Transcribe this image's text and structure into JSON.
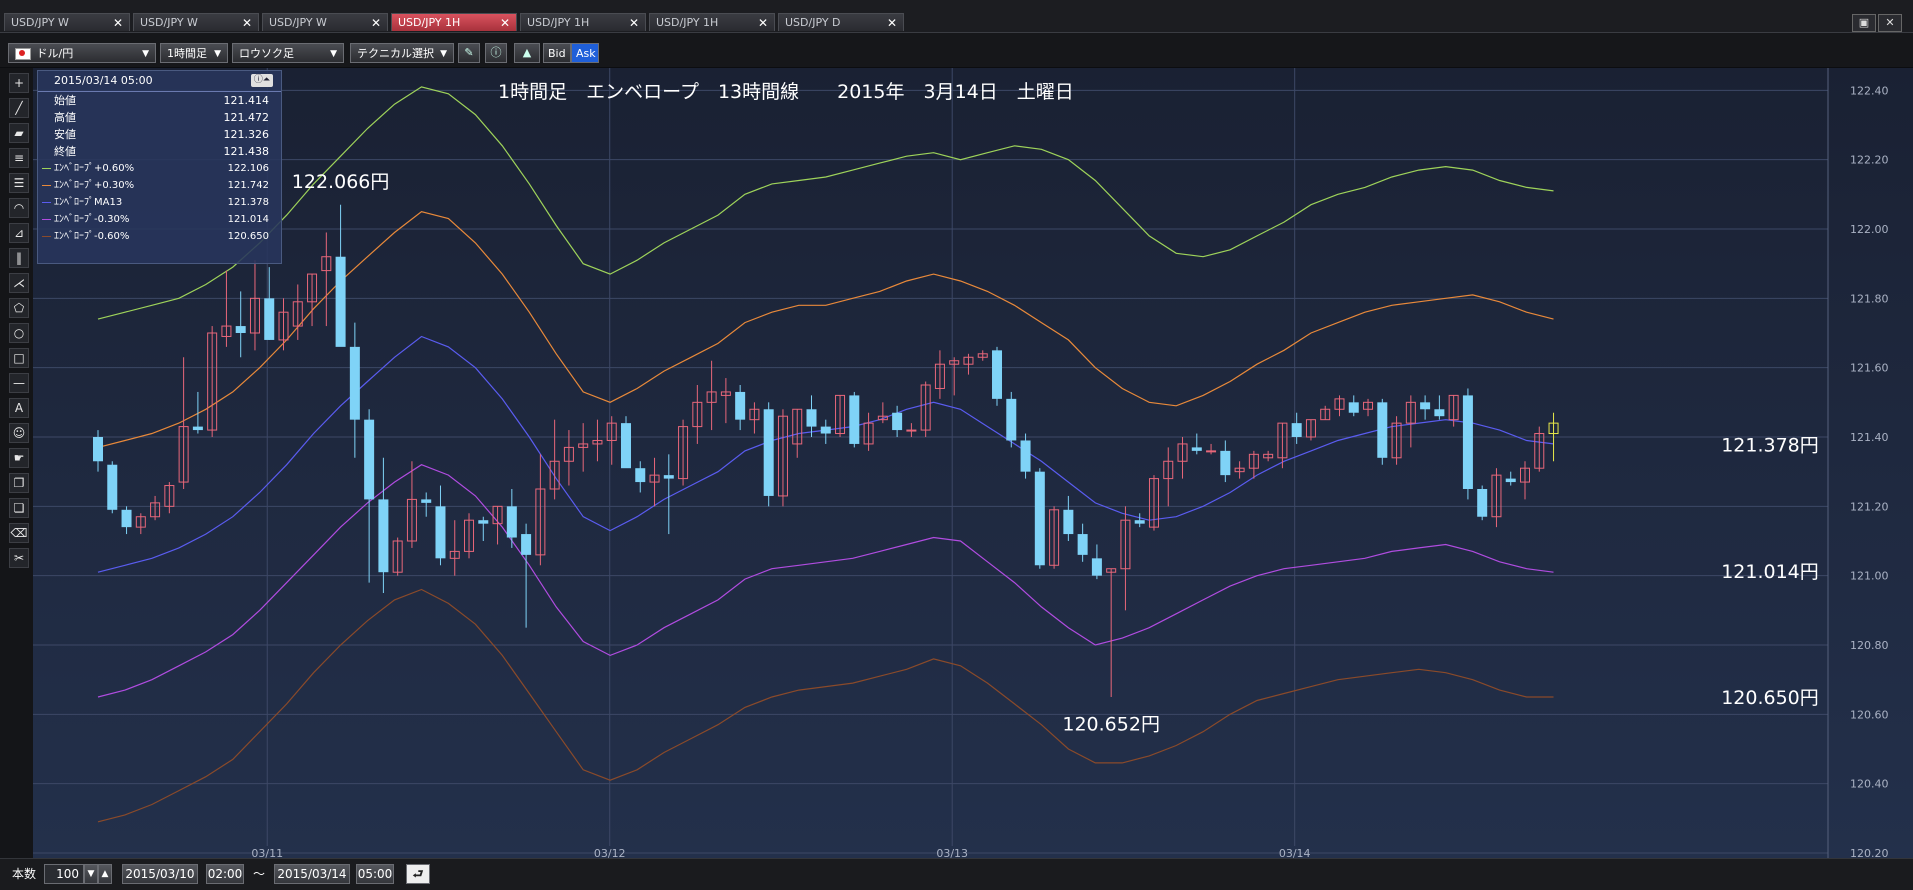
{
  "tabs": [
    {
      "label": "USD/JPY W",
      "active": false
    },
    {
      "label": "USD/JPY W",
      "active": false
    },
    {
      "label": "USD/JPY W",
      "active": false
    },
    {
      "label": "USD/JPY 1H",
      "active": true
    },
    {
      "label": "USD/JPY 1H",
      "active": false
    },
    {
      "label": "USD/JPY 1H",
      "active": false
    },
    {
      "label": "USD/JPY D",
      "active": false
    }
  ],
  "toolbar": {
    "symbol": "ドル/円",
    "timeframe": "1時間足",
    "chart_type": "ロウソク足",
    "technical": "テクニカル選択",
    "bid": "Bid",
    "ask": "Ask"
  },
  "ohlc_panel": {
    "datetime": "2015/03/14 05:00",
    "rows": [
      {
        "label": "始値",
        "value": "121.414"
      },
      {
        "label": "高値",
        "value": "121.472"
      },
      {
        "label": "安値",
        "value": "121.326"
      },
      {
        "label": "終値",
        "value": "121.438"
      }
    ],
    "indicators": [
      {
        "label": "ｴﾝﾍﾞﾛｰﾌﾟ+0.60%",
        "value": "122.106",
        "color": "#9ed35a"
      },
      {
        "label": "ｴﾝﾍﾞﾛｰﾌﾟ+0.30%",
        "value": "121.742",
        "color": "#e8893a"
      },
      {
        "label": "ｴﾝﾍﾞﾛｰﾌﾟMA13",
        "value": "121.378",
        "color": "#5a5cf0"
      },
      {
        "label": "ｴﾝﾍﾞﾛｰﾌﾟ-0.30%",
        "value": "121.014",
        "color": "#b04ce0"
      },
      {
        "label": "ｴﾝﾍﾞﾛｰﾌﾟ-0.60%",
        "value": "120.650",
        "color": "#8a4a2a"
      }
    ]
  },
  "bottom": {
    "count_label": "本数",
    "count": "100",
    "from_date": "2015/03/10",
    "from_time": "02:00",
    "tilde": "～",
    "to_date": "2015/03/14",
    "to_time": "05:00"
  },
  "chart_data": {
    "type": "candlestick",
    "title": "1時間足　エンベロープ　13時間線　　2015年　3月14日　土曜日",
    "ylim": [
      120.2,
      122.45
    ],
    "yticks": [
      "122.40",
      "122.20",
      "122.00",
      "121.80",
      "121.60",
      "121.40",
      "121.20",
      "121.00",
      "120.80",
      "120.60",
      "120.40",
      "120.20"
    ],
    "xticks": [
      {
        "label": "03/11",
        "index": 12
      },
      {
        "label": "03/12",
        "index": 36
      },
      {
        "label": "03/13",
        "index": 60
      },
      {
        "label": "03/14",
        "index": 84
      }
    ],
    "colors": {
      "up": "#e8677a",
      "down": "#7fd3f7",
      "last": "#e8e84a"
    },
    "candles": [
      [
        121.4,
        121.42,
        121.3,
        121.33
      ],
      [
        121.32,
        121.33,
        121.18,
        121.19
      ],
      [
        121.19,
        121.2,
        121.12,
        121.14
      ],
      [
        121.14,
        121.18,
        121.12,
        121.17
      ],
      [
        121.17,
        121.23,
        121.16,
        121.21
      ],
      [
        121.2,
        121.27,
        121.18,
        121.26
      ],
      [
        121.27,
        121.63,
        121.25,
        121.43
      ],
      [
        121.43,
        121.53,
        121.41,
        121.42
      ],
      [
        121.42,
        121.72,
        121.4,
        121.7
      ],
      [
        121.69,
        121.88,
        121.66,
        121.72
      ],
      [
        121.72,
        121.82,
        121.63,
        121.7
      ],
      [
        121.7,
        121.91,
        121.65,
        121.8
      ],
      [
        121.8,
        121.89,
        121.68,
        121.68
      ],
      [
        121.68,
        121.8,
        121.65,
        121.76
      ],
      [
        121.72,
        121.84,
        121.68,
        121.79
      ],
      [
        121.79,
        121.87,
        121.72,
        121.87
      ],
      [
        121.88,
        121.99,
        121.72,
        121.92
      ],
      [
        121.92,
        122.07,
        121.85,
        121.66
      ],
      [
        121.66,
        121.73,
        121.34,
        121.45
      ],
      [
        121.45,
        121.48,
        120.98,
        121.22
      ],
      [
        121.22,
        121.34,
        120.95,
        121.01
      ],
      [
        121.01,
        121.11,
        121.0,
        121.1
      ],
      [
        121.1,
        121.33,
        121.08,
        121.22
      ],
      [
        121.22,
        121.24,
        121.17,
        121.21
      ],
      [
        121.2,
        121.26,
        121.03,
        121.05
      ],
      [
        121.05,
        121.16,
        121.0,
        121.07
      ],
      [
        121.07,
        121.18,
        121.05,
        121.16
      ],
      [
        121.16,
        121.17,
        121.1,
        121.15
      ],
      [
        121.15,
        121.2,
        121.09,
        121.2
      ],
      [
        121.2,
        121.25,
        121.08,
        121.11
      ],
      [
        121.12,
        121.15,
        120.85,
        121.06
      ],
      [
        121.06,
        121.35,
        121.03,
        121.25
      ],
      [
        121.25,
        121.45,
        121.22,
        121.33
      ],
      [
        121.33,
        121.42,
        121.26,
        121.37
      ],
      [
        121.37,
        121.44,
        121.3,
        121.38
      ],
      [
        121.38,
        121.45,
        121.33,
        121.39
      ],
      [
        121.39,
        121.46,
        121.32,
        121.44
      ],
      [
        121.44,
        121.46,
        121.34,
        121.31
      ],
      [
        121.31,
        121.33,
        121.24,
        121.27
      ],
      [
        121.27,
        121.34,
        121.2,
        121.29
      ],
      [
        121.29,
        121.35,
        121.12,
        121.28
      ],
      [
        121.28,
        121.45,
        121.26,
        121.43
      ],
      [
        121.43,
        121.55,
        121.38,
        121.5
      ],
      [
        121.5,
        121.62,
        121.42,
        121.53
      ],
      [
        121.52,
        121.57,
        121.44,
        121.53
      ],
      [
        121.53,
        121.55,
        121.42,
        121.45
      ],
      [
        121.45,
        121.5,
        121.41,
        121.48
      ],
      [
        121.48,
        121.5,
        121.2,
        121.23
      ],
      [
        121.23,
        121.48,
        121.2,
        121.46
      ],
      [
        121.38,
        121.48,
        121.34,
        121.48
      ],
      [
        121.48,
        121.52,
        121.4,
        121.43
      ],
      [
        121.43,
        121.45,
        121.38,
        121.41
      ],
      [
        121.41,
        121.52,
        121.4,
        121.52
      ],
      [
        121.52,
        121.53,
        121.37,
        121.38
      ],
      [
        121.38,
        121.47,
        121.36,
        121.44
      ],
      [
        121.45,
        121.5,
        121.44,
        121.46
      ],
      [
        121.47,
        121.49,
        121.4,
        121.42
      ],
      [
        121.42,
        121.44,
        121.4,
        121.42
      ],
      [
        121.42,
        121.56,
        121.4,
        121.55
      ],
      [
        121.54,
        121.65,
        121.51,
        121.61
      ],
      [
        121.61,
        121.63,
        121.52,
        121.62
      ],
      [
        121.61,
        121.64,
        121.58,
        121.63
      ],
      [
        121.63,
        121.65,
        121.62,
        121.64
      ],
      [
        121.65,
        121.66,
        121.49,
        121.51
      ],
      [
        121.51,
        121.53,
        121.37,
        121.39
      ],
      [
        121.39,
        121.41,
        121.28,
        121.3
      ],
      [
        121.3,
        121.31,
        121.02,
        121.03
      ],
      [
        121.03,
        121.2,
        121.02,
        121.19
      ],
      [
        121.19,
        121.23,
        121.1,
        121.12
      ],
      [
        121.12,
        121.15,
        121.04,
        121.06
      ],
      [
        121.05,
        121.09,
        120.99,
        121.0
      ],
      [
        121.01,
        121.02,
        120.65,
        121.02
      ],
      [
        121.02,
        121.2,
        120.9,
        121.16
      ],
      [
        121.16,
        121.18,
        121.14,
        121.15
      ],
      [
        121.14,
        121.29,
        121.13,
        121.28
      ],
      [
        121.28,
        121.37,
        121.2,
        121.33
      ],
      [
        121.33,
        121.4,
        121.28,
        121.38
      ],
      [
        121.37,
        121.41,
        121.35,
        121.36
      ],
      [
        121.36,
        121.38,
        121.35,
        121.36
      ],
      [
        121.36,
        121.39,
        121.27,
        121.29
      ],
      [
        121.3,
        121.33,
        121.28,
        121.31
      ],
      [
        121.31,
        121.36,
        121.28,
        121.35
      ],
      [
        121.34,
        121.36,
        121.33,
        121.35
      ],
      [
        121.34,
        121.44,
        121.31,
        121.44
      ],
      [
        121.44,
        121.47,
        121.38,
        121.4
      ],
      [
        121.4,
        121.45,
        121.39,
        121.45
      ],
      [
        121.45,
        121.49,
        121.45,
        121.48
      ],
      [
        121.48,
        121.52,
        121.46,
        121.51
      ],
      [
        121.5,
        121.52,
        121.46,
        121.47
      ],
      [
        121.48,
        121.51,
        121.46,
        121.5
      ],
      [
        121.5,
        121.51,
        121.32,
        121.34
      ],
      [
        121.34,
        121.46,
        121.32,
        121.44
      ],
      [
        121.44,
        121.52,
        121.37,
        121.5
      ],
      [
        121.5,
        121.52,
        121.45,
        121.48
      ],
      [
        121.48,
        121.52,
        121.45,
        121.46
      ],
      [
        121.45,
        121.52,
        121.43,
        121.52
      ],
      [
        121.52,
        121.54,
        121.22,
        121.25
      ],
      [
        121.25,
        121.26,
        121.16,
        121.17
      ],
      [
        121.17,
        121.31,
        121.14,
        121.29
      ],
      [
        121.28,
        121.3,
        121.26,
        121.27
      ],
      [
        121.27,
        121.33,
        121.22,
        121.31
      ],
      [
        121.31,
        121.43,
        121.3,
        121.41
      ],
      [
        121.41,
        121.47,
        121.33,
        121.44
      ]
    ],
    "series": [
      {
        "name": "ｴﾝﾍﾞﾛｰﾌﾟ+0.60%",
        "color": "#9ed35a",
        "values": [
          121.74,
          121.76,
          121.78,
          121.8,
          121.84,
          121.89,
          121.96,
          122.04,
          122.13,
          122.21,
          122.29,
          122.36,
          122.41,
          122.39,
          122.33,
          122.24,
          122.13,
          122.01,
          121.9,
          121.87,
          121.91,
          121.96,
          122.0,
          122.04,
          122.1,
          122.13,
          122.14,
          122.15,
          122.17,
          122.19,
          122.21,
          122.22,
          122.2,
          122.22,
          122.24,
          122.23,
          122.2,
          122.14,
          122.06,
          121.98,
          121.93,
          121.92,
          121.94,
          121.98,
          122.02,
          122.07,
          122.1,
          122.12,
          122.15,
          122.17,
          122.18,
          122.17,
          122.14,
          122.12,
          122.11
        ]
      },
      {
        "name": "ｴﾝﾍﾞﾛｰﾌﾟ+0.30%",
        "color": "#e8893a",
        "values": [
          121.37,
          121.39,
          121.41,
          121.44,
          121.48,
          121.53,
          121.6,
          121.68,
          121.77,
          121.85,
          121.92,
          121.99,
          122.05,
          122.03,
          121.96,
          121.87,
          121.76,
          121.64,
          121.53,
          121.5,
          121.54,
          121.59,
          121.63,
          121.67,
          121.73,
          121.76,
          121.78,
          121.78,
          121.8,
          121.82,
          121.85,
          121.87,
          121.85,
          121.82,
          121.78,
          121.73,
          121.68,
          121.6,
          121.54,
          121.5,
          121.49,
          121.52,
          121.56,
          121.61,
          121.65,
          121.7,
          121.73,
          121.76,
          121.78,
          121.79,
          121.8,
          121.81,
          121.79,
          121.76,
          121.74
        ]
      },
      {
        "name": "ｴﾝﾍﾞﾛｰﾌﾟMA13",
        "color": "#5a5cf0",
        "values": [
          121.01,
          121.03,
          121.05,
          121.08,
          121.12,
          121.17,
          121.24,
          121.32,
          121.41,
          121.49,
          121.56,
          121.63,
          121.69,
          121.66,
          121.6,
          121.51,
          121.4,
          121.28,
          121.17,
          121.13,
          121.17,
          121.22,
          121.26,
          121.3,
          121.36,
          121.39,
          121.41,
          121.42,
          121.43,
          121.45,
          121.48,
          121.5,
          121.48,
          121.43,
          121.38,
          121.33,
          121.27,
          121.21,
          121.18,
          121.16,
          121.17,
          121.2,
          121.24,
          121.29,
          121.33,
          121.36,
          121.39,
          121.41,
          121.43,
          121.44,
          121.45,
          121.44,
          121.42,
          121.39,
          121.38
        ]
      },
      {
        "name": "ｴﾝﾍﾞﾛｰﾌﾟ-0.30%",
        "color": "#b04ce0",
        "values": [
          120.65,
          120.67,
          120.7,
          120.74,
          120.78,
          120.83,
          120.9,
          120.98,
          121.06,
          121.14,
          121.21,
          121.27,
          121.32,
          121.29,
          121.23,
          121.14,
          121.03,
          120.91,
          120.81,
          120.77,
          120.8,
          120.85,
          120.89,
          120.93,
          120.99,
          121.02,
          121.03,
          121.04,
          121.05,
          121.07,
          121.09,
          121.11,
          121.1,
          121.04,
          120.98,
          120.91,
          120.85,
          120.8,
          120.82,
          120.85,
          120.89,
          120.93,
          120.97,
          121.0,
          121.02,
          121.03,
          121.04,
          121.05,
          121.07,
          121.08,
          121.09,
          121.07,
          121.04,
          121.02,
          121.01
        ]
      },
      {
        "name": "ｴﾝﾍﾞﾛｰﾌﾟ-0.60%",
        "color": "#8a4a2a",
        "values": [
          120.29,
          120.31,
          120.34,
          120.38,
          120.42,
          120.47,
          120.55,
          120.63,
          120.72,
          120.8,
          120.87,
          120.93,
          120.96,
          120.92,
          120.86,
          120.77,
          120.66,
          120.55,
          120.44,
          120.41,
          120.44,
          120.49,
          120.53,
          120.57,
          120.62,
          120.65,
          120.67,
          120.68,
          120.69,
          120.71,
          120.73,
          120.76,
          120.74,
          120.69,
          120.63,
          120.57,
          120.5,
          120.46,
          120.46,
          120.48,
          120.51,
          120.55,
          120.6,
          120.64,
          120.66,
          120.68,
          120.7,
          120.71,
          120.72,
          120.73,
          120.72,
          120.7,
          120.67,
          120.65,
          120.65
        ]
      }
    ],
    "annotations": [
      {
        "text": "122.066円",
        "x": 17,
        "y": 122.066
      },
      {
        "text": "120.652円",
        "x": 71,
        "y": 120.652
      }
    ],
    "right_labels": [
      {
        "text": "121.378円",
        "y": 121.378
      },
      {
        "text": "121.014円",
        "y": 121.014
      },
      {
        "text": "120.650円",
        "y": 120.65
      }
    ]
  }
}
